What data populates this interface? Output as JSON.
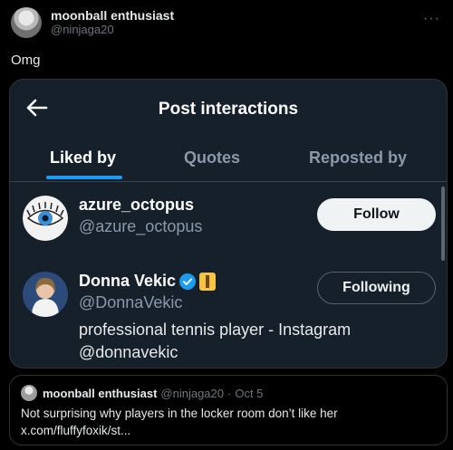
{
  "tweet": {
    "author_name": "moonball enthusiast",
    "author_handle": "@ninjaga20",
    "text": "Omg",
    "more_icon": "more-horizontal-icon"
  },
  "screenshot": {
    "title": "Post interactions",
    "back_icon": "arrow-left-icon",
    "tabs": [
      {
        "label": "Liked by",
        "active": true
      },
      {
        "label": "Quotes",
        "active": false
      },
      {
        "label": "Reposted by",
        "active": false
      }
    ],
    "users": [
      {
        "name": "azure_octopus",
        "handle": "@azure_octopus",
        "button": "Follow",
        "bio": ""
      },
      {
        "name": "Donna Vekic",
        "handle": "@DonnaVekic",
        "button": "Following",
        "verified": true,
        "bio": "professional tennis player - Instagram @donnavekic"
      }
    ]
  },
  "quote": {
    "author_name": "moonball enthusiast",
    "author_handle": "@ninjaga20",
    "separator": "·",
    "date": "Oct 5",
    "text": "Not surprising why players in the locker room don’t like her x.com/fluffyfoxik/st..."
  },
  "colors": {
    "accent": "#1d9bf0",
    "background": "#000000",
    "card": "#15202b"
  }
}
